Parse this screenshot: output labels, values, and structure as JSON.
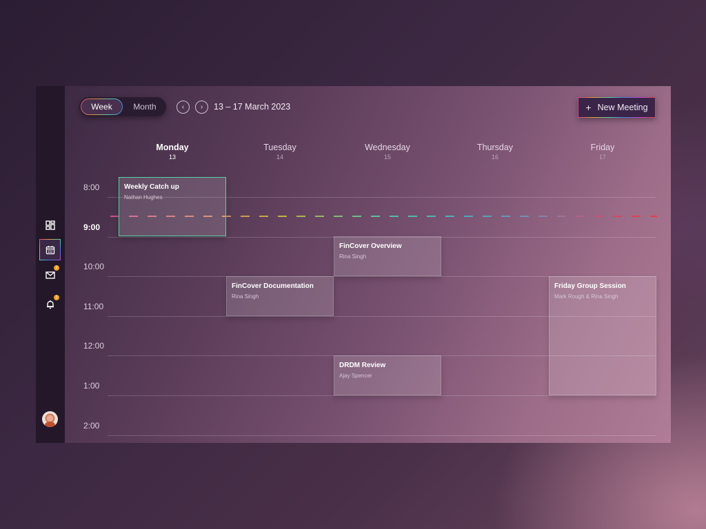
{
  "sidebar": {
    "items": [
      {
        "name": "dashboard",
        "icon": "dashboard-icon",
        "active": false
      },
      {
        "name": "calendar",
        "icon": "calendar-icon",
        "active": true
      },
      {
        "name": "mail",
        "icon": "mail-icon",
        "active": false,
        "badge": "2"
      },
      {
        "name": "notifications",
        "icon": "bell-icon",
        "active": false,
        "badge": "2"
      }
    ],
    "avatar": "user-avatar"
  },
  "header": {
    "view_toggle": {
      "week": "Week",
      "month": "Month",
      "selected": "Week"
    },
    "prev_icon": "‹",
    "next_icon": "›",
    "date_range": "13 – 17 March 2023",
    "new_meeting": {
      "icon": "+",
      "label": "New Meeting"
    }
  },
  "days": [
    {
      "name": "Monday",
      "date": "13",
      "today": true
    },
    {
      "name": "Tuesday",
      "date": "14",
      "today": false
    },
    {
      "name": "Wednesday",
      "date": "15",
      "today": false
    },
    {
      "name": "Thursday",
      "date": "16",
      "today": false
    },
    {
      "name": "Friday",
      "date": "17",
      "today": false
    }
  ],
  "hours": [
    "8:00",
    "9:00",
    "10:00",
    "11:00",
    "12:00",
    "1:00",
    "2:00"
  ],
  "current_hour": "9:00",
  "events": [
    {
      "title": "Weekly Catch up",
      "person": "Nathan Hughes",
      "day": "Monday",
      "start": "8:00",
      "end": "9:30",
      "selected": true
    },
    {
      "title": "FinCover Overview",
      "person": "Rina Singh",
      "day": "Wednesday",
      "start": "9:30",
      "end": "10:30",
      "selected": false
    },
    {
      "title": "FinCover Documentation",
      "person": "Rina Singh",
      "day": "Tuesday",
      "start": "10:30",
      "end": "11:30",
      "selected": false
    },
    {
      "title": "Friday Group Session",
      "person": "Mark Rough & Rina Singh",
      "day": "Friday",
      "start": "10:30",
      "end": "13:30",
      "selected": false
    },
    {
      "title": "DRDM Review",
      "person": "Ajay Spencer",
      "day": "Wednesday",
      "start": "12:30",
      "end": "13:30",
      "selected": false
    }
  ]
}
